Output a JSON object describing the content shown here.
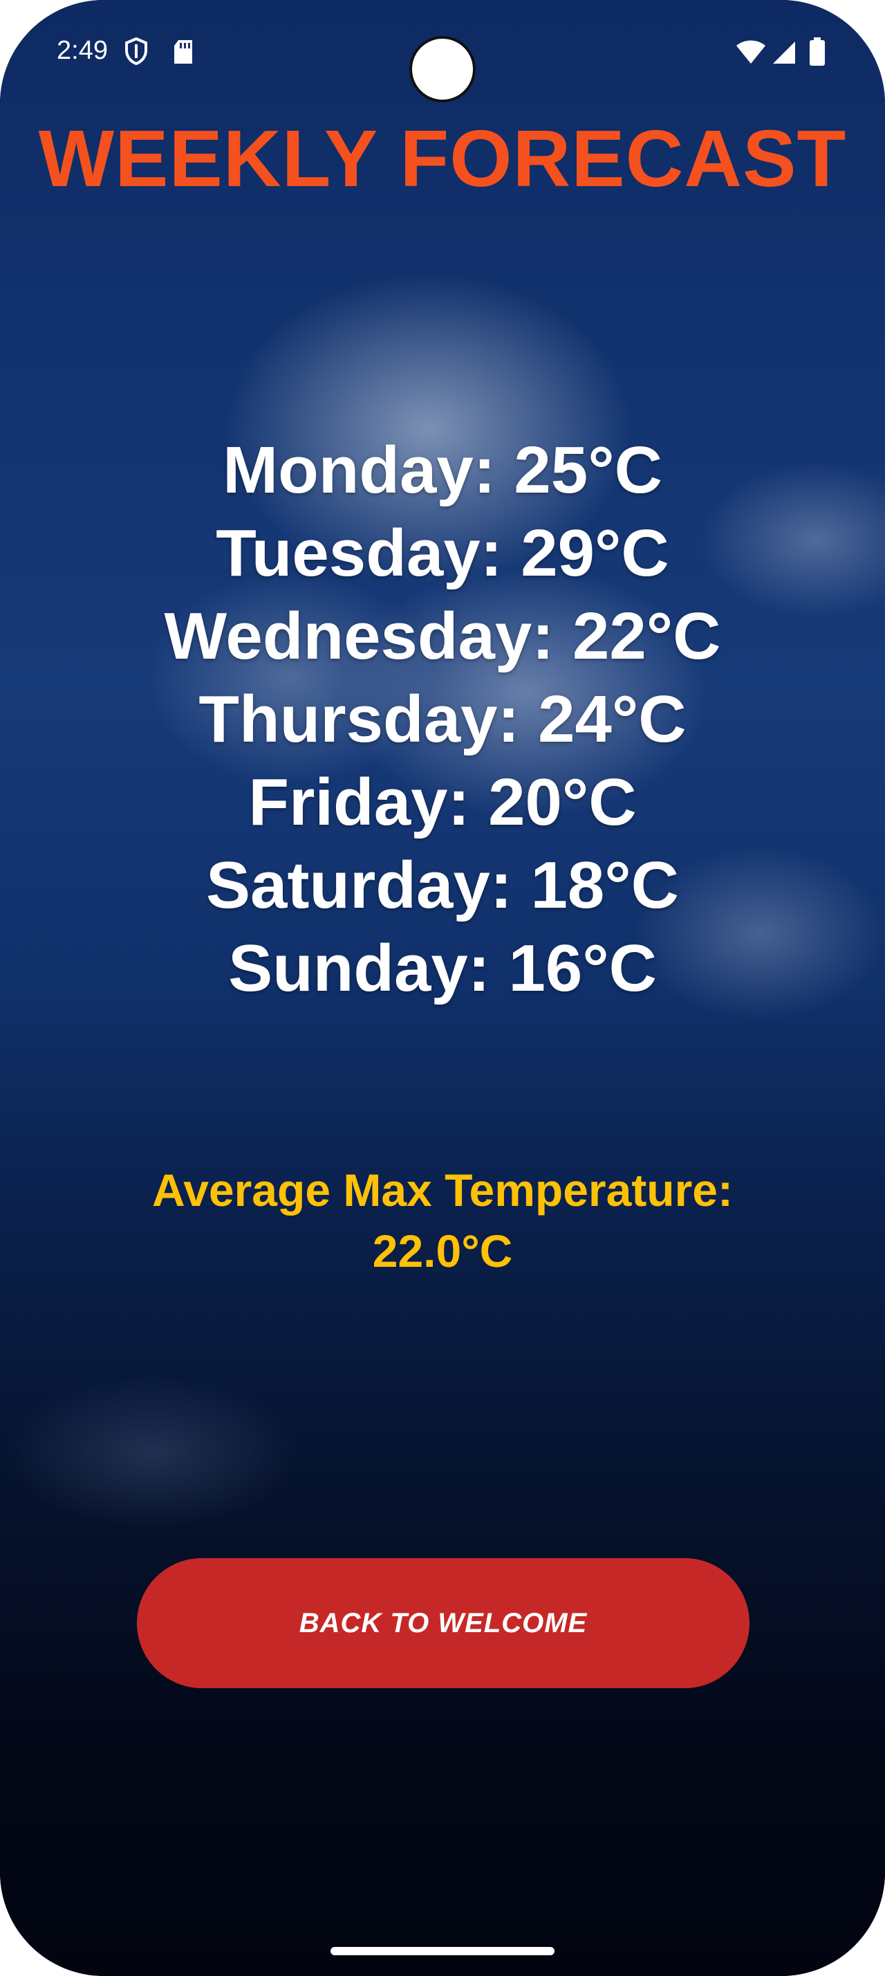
{
  "status_bar": {
    "time": "2:49",
    "icons": [
      "shield-icon",
      "sd-card-icon",
      "wifi-icon",
      "signal-icon",
      "battery-icon"
    ]
  },
  "title": "WEEKLY FORECAST",
  "forecast": [
    {
      "day": "Monday",
      "text": "Monday: 25°C"
    },
    {
      "day": "Tuesday",
      "text": "Tuesday: 29°C"
    },
    {
      "day": "Wednesday",
      "text": "Wednesday: 22°C"
    },
    {
      "day": "Thursday",
      "text": "Thursday: 24°C"
    },
    {
      "day": "Friday",
      "text": "Friday: 20°C"
    },
    {
      "day": "Saturday",
      "text": "Saturday: 18°C"
    },
    {
      "day": "Sunday",
      "text": "Sunday: 16°C"
    }
  ],
  "average": {
    "label": "Average Max Temperature:",
    "value": "22.0°C"
  },
  "back_button": {
    "label": "BACK TO WELCOME"
  },
  "colors": {
    "title": "#f4511e",
    "average": "#ffc107",
    "button": "#c62828",
    "text": "#ffffff"
  }
}
